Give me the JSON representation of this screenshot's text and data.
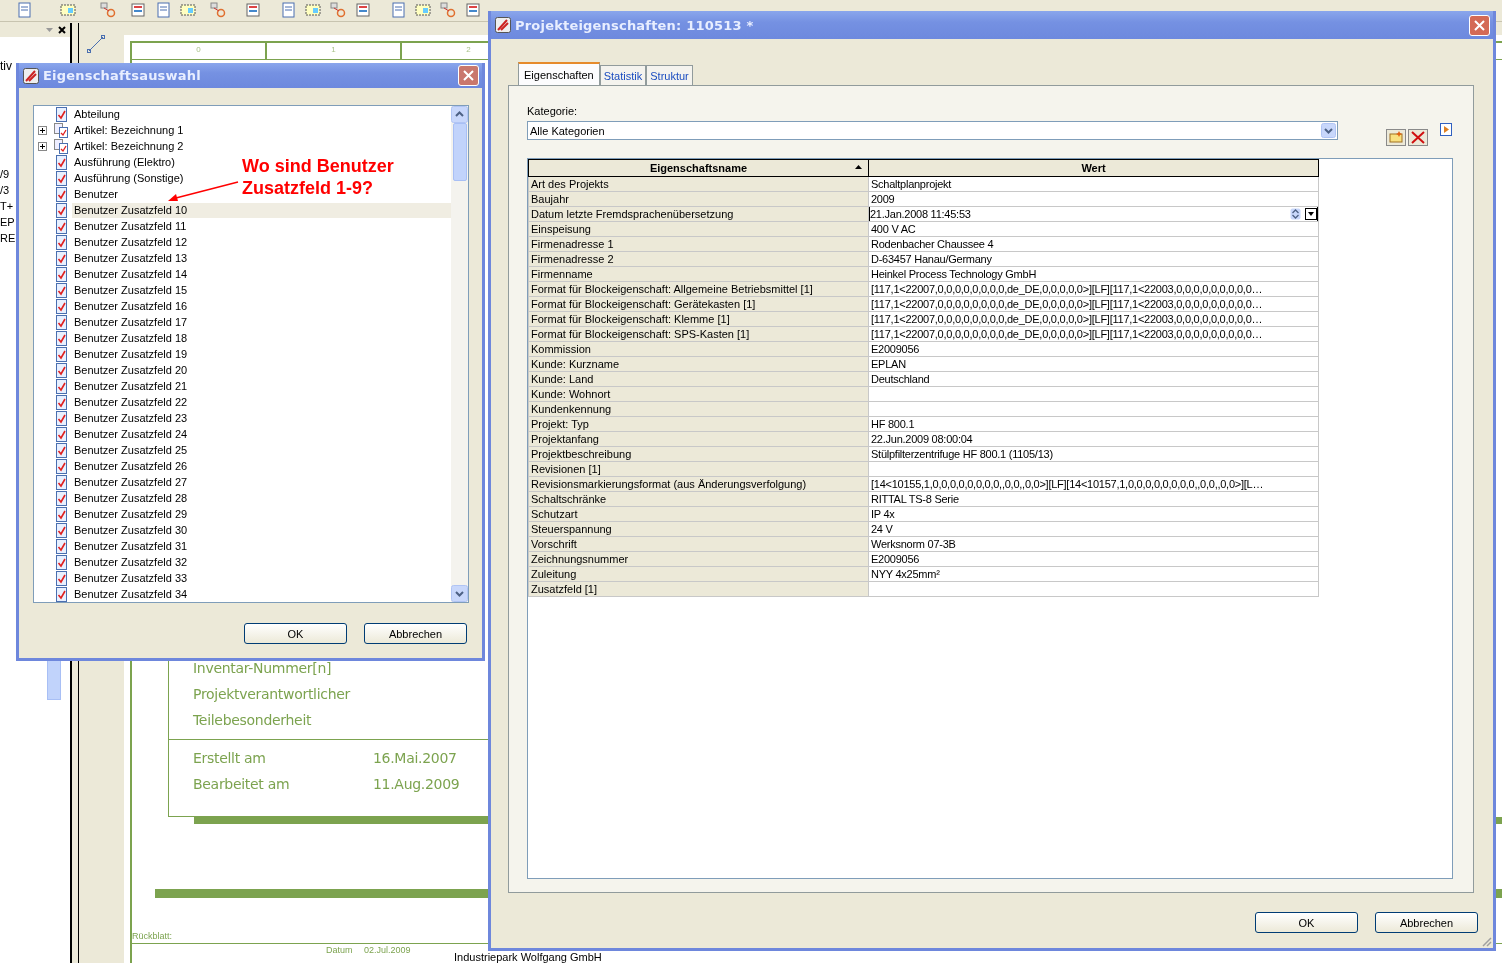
{
  "background": {
    "side_panel": {
      "label": "tiv",
      "fragments": [
        "/9",
        "/3",
        "T+",
        "EP",
        "RE"
      ]
    },
    "sheet": {
      "column_numbers": [
        "0",
        "1",
        "2"
      ],
      "fields": [
        "Inventar-Nummer[n]",
        "Projektverantwortlicher",
        "Teilebesonderheit"
      ],
      "dates": [
        {
          "label": "Erstellt am",
          "value": "16.Mai.2007"
        },
        {
          "label": "Bearbeitet am",
          "value": "11.Aug.2009"
        }
      ],
      "back_sheet_label": "Rückblatt:",
      "footer": {
        "date_label": "Datum",
        "date": "02.Jul.2009",
        "company": "Industriepark Wolfgang GmbH"
      }
    }
  },
  "selection_dialog": {
    "title": "Eigenschaftsauswahl",
    "items": [
      {
        "label": "Abteilung",
        "kind": "property",
        "selected": false
      },
      {
        "label": "Artikel: Bezeichnung 1",
        "kind": "group",
        "expanded": false,
        "selected": false
      },
      {
        "label": "Artikel: Bezeichnung 2",
        "kind": "group",
        "expanded": false,
        "selected": false
      },
      {
        "label": "Ausführung (Elektro)",
        "kind": "property",
        "selected": false
      },
      {
        "label": "Ausführung (Sonstige)",
        "kind": "property",
        "selected": false
      },
      {
        "label": "Benutzer",
        "kind": "property",
        "selected": false
      },
      {
        "label": "Benutzer Zusatzfeld 10",
        "kind": "property",
        "selected": true
      },
      {
        "label": "Benutzer Zusatzfeld 11",
        "kind": "property",
        "selected": false
      },
      {
        "label": "Benutzer Zusatzfeld 12",
        "kind": "property",
        "selected": false
      },
      {
        "label": "Benutzer Zusatzfeld 13",
        "kind": "property",
        "selected": false
      },
      {
        "label": "Benutzer Zusatzfeld 14",
        "kind": "property",
        "selected": false
      },
      {
        "label": "Benutzer Zusatzfeld 15",
        "kind": "property",
        "selected": false
      },
      {
        "label": "Benutzer Zusatzfeld 16",
        "kind": "property",
        "selected": false
      },
      {
        "label": "Benutzer Zusatzfeld 17",
        "kind": "property",
        "selected": false
      },
      {
        "label": "Benutzer Zusatzfeld 18",
        "kind": "property",
        "selected": false
      },
      {
        "label": "Benutzer Zusatzfeld 19",
        "kind": "property",
        "selected": false
      },
      {
        "label": "Benutzer Zusatzfeld 20",
        "kind": "property",
        "selected": false
      },
      {
        "label": "Benutzer Zusatzfeld 21",
        "kind": "property",
        "selected": false
      },
      {
        "label": "Benutzer Zusatzfeld 22",
        "kind": "property",
        "selected": false
      },
      {
        "label": "Benutzer Zusatzfeld 23",
        "kind": "property",
        "selected": false
      },
      {
        "label": "Benutzer Zusatzfeld 24",
        "kind": "property",
        "selected": false
      },
      {
        "label": "Benutzer Zusatzfeld 25",
        "kind": "property",
        "selected": false
      },
      {
        "label": "Benutzer Zusatzfeld 26",
        "kind": "property",
        "selected": false
      },
      {
        "label": "Benutzer Zusatzfeld 27",
        "kind": "property",
        "selected": false
      },
      {
        "label": "Benutzer Zusatzfeld 28",
        "kind": "property",
        "selected": false
      },
      {
        "label": "Benutzer Zusatzfeld 29",
        "kind": "property",
        "selected": false
      },
      {
        "label": "Benutzer Zusatzfeld 30",
        "kind": "property",
        "selected": false
      },
      {
        "label": "Benutzer Zusatzfeld 31",
        "kind": "property",
        "selected": false
      },
      {
        "label": "Benutzer Zusatzfeld 32",
        "kind": "property",
        "selected": false
      },
      {
        "label": "Benutzer Zusatzfeld 33",
        "kind": "property",
        "selected": false
      },
      {
        "label": "Benutzer Zusatzfeld 34",
        "kind": "property",
        "selected": false
      }
    ],
    "annotation": "Wo sind Benutzer Zusatzfeld 1-9?",
    "buttons": [
      "OK",
      "Abbrechen"
    ]
  },
  "properties_dialog": {
    "title": "Projekteigenschaften: 110513 *",
    "tabs": [
      {
        "label": "Eigenschaften",
        "selected": true
      },
      {
        "label": "Statistik",
        "selected": false
      },
      {
        "label": "Struktur",
        "selected": false
      }
    ],
    "category_label": "Kategorie:",
    "category": "Alle Kategorien",
    "table": {
      "columns": [
        {
          "label": "Eigenschaftsname",
          "sorted": true
        },
        {
          "label": "Wert",
          "sorted": false
        }
      ],
      "rows": [
        {
          "name": "Art des Projekts",
          "value": "Schaltplanprojekt",
          "editing": false
        },
        {
          "name": "Baujahr",
          "value": "2009",
          "editing": false
        },
        {
          "name": "Datum letzte Fremdsprachenübersetzung",
          "value": "21.Jan.2008 11:45:53",
          "editing": true
        },
        {
          "name": "Einspeisung",
          "value": "400 V AC",
          "editing": false
        },
        {
          "name": "Firmenadresse 1",
          "value": "Rodenbacher Chaussee 4",
          "editing": false
        },
        {
          "name": "Firmenadresse 2",
          "value": "D-63457 Hanau/Germany",
          "editing": false
        },
        {
          "name": "Firmenname",
          "value": "Heinkel Process Technology GmbH",
          "editing": false
        },
        {
          "name": "Format für Blockeigenschaft: Allgemeine Betriebsmittel [1]",
          "value": "[117,1<22007,0,0,0,0,0,0,0,0,de_DE,0,0,0,0,0>][LF][117,1<22003,0,0,0,0,0,0,0,0,0…",
          "editing": false
        },
        {
          "name": "Format für Blockeigenschaft: Gerätekasten [1]",
          "value": "[117,1<22007,0,0,0,0,0,0,0,0,de_DE,0,0,0,0,0>][LF][117,1<22003,0,0,0,0,0,0,0,0,0…",
          "editing": false
        },
        {
          "name": "Format für Blockeigenschaft: Klemme [1]",
          "value": "[117,1<22007,0,0,0,0,0,0,0,0,de_DE,0,0,0,0,0>][LF][117,1<22003,0,0,0,0,0,0,0,0,0…",
          "editing": false
        },
        {
          "name": "Format für Blockeigenschaft: SPS-Kasten [1]",
          "value": "[117,1<22007,0,0,0,0,0,0,0,0,de_DE,0,0,0,0,0>][LF][117,1<22003,0,0,0,0,0,0,0,0,0…",
          "editing": false
        },
        {
          "name": "Kommission",
          "value": "E2009056",
          "editing": false
        },
        {
          "name": "Kunde: Kurzname",
          "value": "EPLAN",
          "editing": false
        },
        {
          "name": "Kunde: Land",
          "value": "Deutschland",
          "editing": false
        },
        {
          "name": "Kunde: Wohnort",
          "editing": false
        },
        {
          "name": "Kundenkennung",
          "editing": false
        },
        {
          "name": "Projekt: Typ",
          "value": "HF 800.1",
          "editing": false
        },
        {
          "name": "Projektanfang",
          "value": "22.Jun.2009 08:00:04",
          "editing": false
        },
        {
          "name": "Projektbeschreibung",
          "value": "Stülpfilterzentrifuge HF 800.1 (1105/13)",
          "editing": false
        },
        {
          "name": "Revisionen [1]",
          "editing": false
        },
        {
          "name": "Revisionsmarkierungsformat (aus Änderungsverfolgung)",
          "value": "[14<10155,1,0,0,0,0,0,0,0,0,,0,0,,0,0>][LF][14<10157,1,0,0,0,0,0,0,0,0,,0,0,,0,0>][L…",
          "editing": false
        },
        {
          "name": "Schaltschränke",
          "value": "RITTAL TS-8 Serie",
          "editing": false
        },
        {
          "name": "Schutzart",
          "value": "IP 4x",
          "editing": false
        },
        {
          "name": "Steuerspannung",
          "value": "24 V",
          "editing": false
        },
        {
          "name": "Vorschrift",
          "value": "Werksnorm 07-3B",
          "editing": false
        },
        {
          "name": "Zeichnungsnummer",
          "value": "E2009056",
          "editing": false
        },
        {
          "name": "Zuleitung",
          "value": "NYY 4x25mm²",
          "editing": false
        },
        {
          "name": "Zusatzfeld [1]",
          "editing": false
        }
      ]
    },
    "buttons": [
      "OK",
      "Abbrechen"
    ]
  }
}
